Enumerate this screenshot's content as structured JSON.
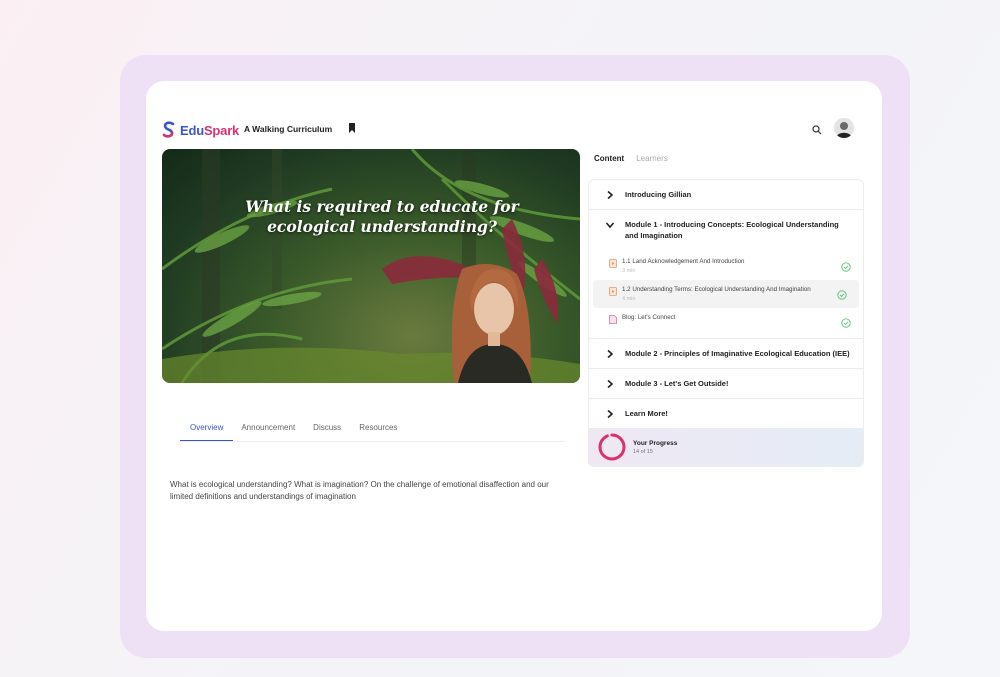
{
  "brand": {
    "name_part1": "Edu",
    "name_part2": "Spark",
    "color_primary": "#3a56c7",
    "color_accent": "#d8336f"
  },
  "header": {
    "course_title": "A Walking Curriculum",
    "icons": [
      "bookmark-icon",
      "search-icon",
      "avatar"
    ]
  },
  "video": {
    "caption": "What is required to educate for ecological understanding?"
  },
  "tabs": [
    "Overview",
    "Announcement",
    "Discuss",
    "Resources"
  ],
  "active_tab": "Overview",
  "description": "What is ecological understanding? What is imagination? On the challenge of emotional disaffection and our limited definitions and understandings of imagination",
  "panel_tabs": {
    "content": "Content",
    "learners": "Learners"
  },
  "modules": [
    {
      "title": "Introducing Gillian",
      "expanded": false
    },
    {
      "title": "Module 1 - Introducing Concepts: Ecological Understanding and Imagination",
      "expanded": true,
      "lessons": [
        {
          "title": "1.1 Land Acknowledgement And Introduction",
          "sub": "3 min",
          "completed": true
        },
        {
          "title": "1.2 Understanding Terms: Ecological Understanding And Imagination",
          "sub": "4 min",
          "completed": true
        },
        {
          "title": "Blog: Let's Connect",
          "sub": "",
          "completed": true
        }
      ]
    },
    {
      "title": "Module 2 - Principles of Imaginative Ecological Education (IEE)",
      "expanded": false
    },
    {
      "title": "Module 3 - Let's Get Outside!",
      "expanded": false
    },
    {
      "title": "Learn More!",
      "expanded": false
    }
  ],
  "progress": {
    "title": "Your Progress",
    "count": "14 of 15",
    "fraction": 0.93
  }
}
